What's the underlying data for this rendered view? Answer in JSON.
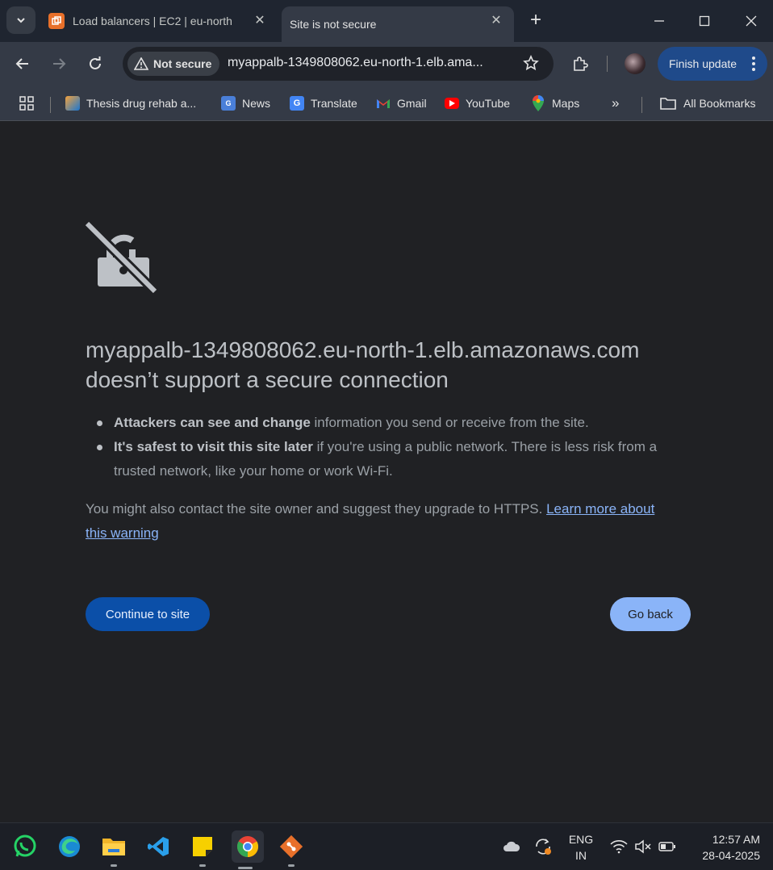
{
  "tabs": [
    {
      "title": "Load balancers | EC2 | eu-north",
      "favicon": "aws-ec2-icon",
      "active": false
    },
    {
      "title": "Site is not secure",
      "active": true
    }
  ],
  "toolbar": {
    "security_chip": "Not secure",
    "url": "myappalb-1349808062.eu-north-1.elb.ama...",
    "finish_update": "Finish update"
  },
  "bookmarks": [
    {
      "label": "Thesis drug rehab a...",
      "icon": "thesis-icon"
    },
    {
      "label": "News",
      "icon": "news-icon"
    },
    {
      "label": "Translate",
      "icon": "translate-icon"
    },
    {
      "label": "Gmail",
      "icon": "gmail-icon"
    },
    {
      "label": "YouTube",
      "icon": "youtube-icon"
    },
    {
      "label": "Maps",
      "icon": "maps-icon"
    }
  ],
  "bookmarks_all": "All Bookmarks",
  "interstitial": {
    "host": "myappalb-1349808062.eu-north-1.elb.amazonaws.com",
    "headline_rest": "doesn’t support a secure connection",
    "bullet1_bold": "Attackers can see and change",
    "bullet1_rest": " information you send or receive from the site.",
    "bullet2_bold": "It's safest to visit this site later",
    "bullet2_rest": " if you're using a public network. There is less risk from a trusted network, like your home or work Wi-Fi.",
    "para_text": "You might also contact the site owner and suggest they upgrade to HTTPS. ",
    "learn_more": "Learn more about this warning",
    "continue_label": "Continue to site",
    "back_label": "Go back"
  },
  "taskbar": {
    "apps": [
      "whatsapp-icon",
      "edge-icon",
      "file-explorer-icon",
      "vscode-icon",
      "sticky-notes-icon",
      "chrome-icon",
      "git-icon"
    ],
    "language_top": "ENG",
    "language_bottom": "IN",
    "time": "12:57 AM",
    "date": "28-04-2025"
  },
  "colors": {
    "accent": "#8ab4f8",
    "continue_button": "#0b4fa8",
    "background": "#202124"
  }
}
